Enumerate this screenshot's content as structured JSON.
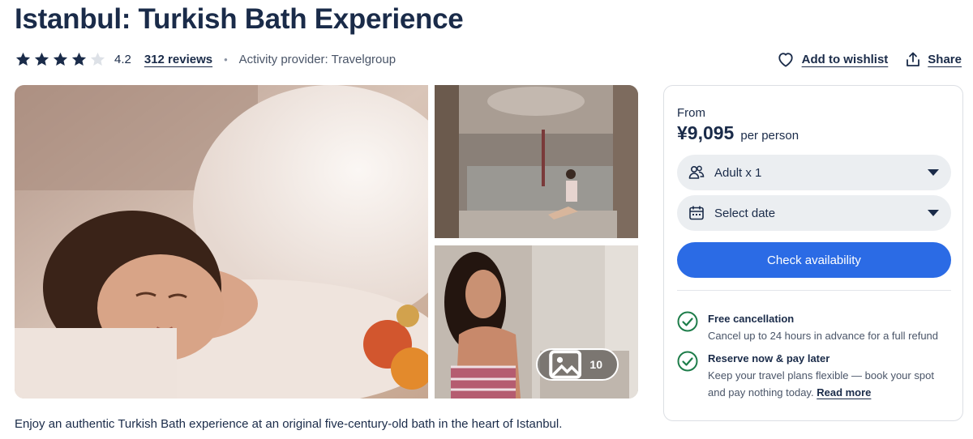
{
  "header": {
    "title": "Istanbul: Turkish Bath Experience",
    "rating": {
      "value": "4.2",
      "stars_total": 5,
      "stars_filled": 4
    },
    "reviews_label": "312 reviews",
    "provider": "Activity provider: Travelgroup",
    "wishlist_label": "Add to wishlist",
    "share_label": "Share"
  },
  "gallery": {
    "photo_count": "10",
    "images": [
      {
        "icon": "photo-woman-foam-bath"
      },
      {
        "icon": "photo-hammam-interior"
      },
      {
        "icon": "photo-woman-hammam-portrait"
      }
    ]
  },
  "booking": {
    "from_label": "From",
    "price": "¥9,095",
    "per_label": "per person",
    "participants": "Adult x 1",
    "date": "Select date",
    "cta_label": "Check availability",
    "features": [
      {
        "title": "Free cancellation",
        "description": "Cancel up to 24 hours in advance for a full refund"
      },
      {
        "title": "Reserve now & pay later",
        "description_line1": "Keep your travel plans flexible — book your spot",
        "description_line2": "and pay nothing today.",
        "link": "Read more"
      }
    ]
  },
  "description": "Enjoy an authentic Turkish Bath experience at an original five-century-old bath in the heart of Istanbul.",
  "colors": {
    "text": "#1a2b49",
    "accent": "#2b6be5",
    "pill_bg": "#ebeef1",
    "check_green": "#1e7d4a"
  }
}
